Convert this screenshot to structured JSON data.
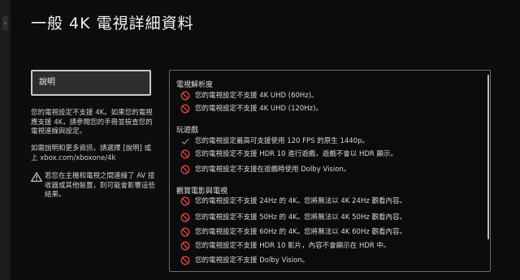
{
  "page_title": "一般 4K 電視詳細資料",
  "side_tab_glyph": "›",
  "help_button_label": "說明",
  "left_panel": {
    "paragraph1": "您的電視設定不支援 4K。如果您的電視應支援 4K，請參閱您的手冊並檢查您的電視連線與設定。",
    "paragraph2": "如需說明和更多資訊，請選擇 [說明] 或上 xbox.com/xboxone/4k",
    "warning": "若您在主機和電視之間連線了 AV 接收器或其他裝置，則可能會影響這些結果。"
  },
  "sections": [
    {
      "heading": "電視解析度",
      "items": [
        {
          "icon": "prohibited-icon",
          "text": "您的電視設定不支援 4K UHD (60Hz)。"
        },
        {
          "icon": "prohibited-icon",
          "text": "您的電視設定不支援 4K UHD (120Hz)。"
        }
      ]
    },
    {
      "heading": "玩遊戲",
      "items": [
        {
          "icon": "checkmark-icon",
          "text": "您的電視設定最高可支援使用 120 FPS 的原生 1440p。"
        },
        {
          "icon": "prohibited-icon",
          "text": "您的電視設定不支援 HDR 10 進行遊戲，遊戲不會以 HDR 顯示。"
        },
        {
          "icon": "prohibited-icon",
          "text": "您的電視設定不支援在遊戲時使用 Dolby Vision。"
        }
      ]
    },
    {
      "heading": "觀賞電影與電視",
      "items": [
        {
          "icon": "prohibited-icon",
          "text": "您的電視設定不支援 24Hz 的 4K。您將無法以 4K 24Hz 觀看內容。"
        },
        {
          "icon": "prohibited-icon",
          "text": "您的電視設定不支援 50Hz 的 4K。您將無法以 4K 50Hz 觀看內容。"
        },
        {
          "icon": "prohibited-icon",
          "text": "您的電視設定不支援 60Hz 的 4K。您將無法以 4K 60Hz 觀看內容。"
        },
        {
          "icon": "prohibited-icon",
          "text": "您的電視設定不支援 HDR 10 影片，內容不會顯示在 HDR 中。"
        },
        {
          "icon": "prohibited-icon",
          "text": "您的電視設定不支援 Dolby Vision。"
        }
      ]
    }
  ],
  "colors": {
    "prohibited": "#e0443e",
    "check": "#8a8a8a",
    "warning": "#d8d8d8"
  }
}
